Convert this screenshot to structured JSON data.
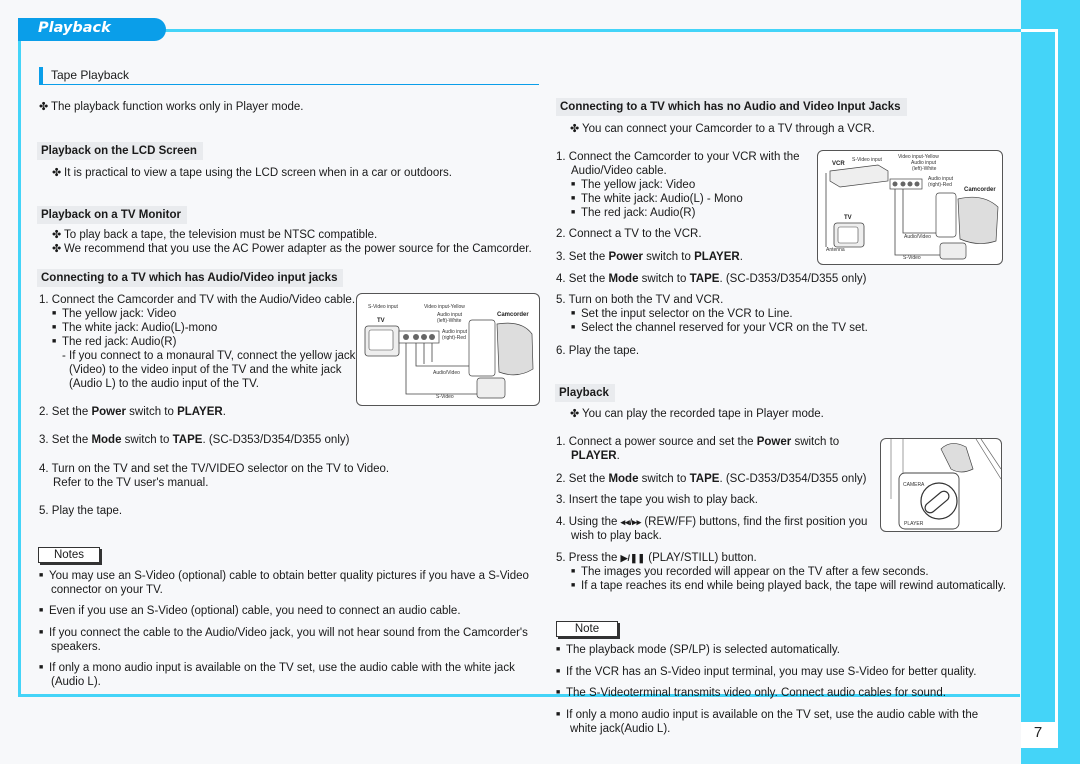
{
  "header": {
    "title": "Playback"
  },
  "section": {
    "title": "Tape Playback"
  },
  "page_number": "7",
  "intro": "The playback function works only in Player mode.",
  "lcd": {
    "heading": "Playback on the LCD Screen",
    "text": "It is practical to view a tape using the LCD screen when in a car or outdoors."
  },
  "tv_monitor": {
    "heading": "Playback on a TV Monitor",
    "items": [
      "To play back a tape, the television must be NTSC compatible.",
      "We recommend that you use the AC Power adapter as the power source for the Camcorder."
    ]
  },
  "av_jacks": {
    "heading": "Connecting to a TV which has Audio/Video input jacks",
    "step1": "1. Connect the Camcorder and TV with the Audio/Video cable.",
    "bullets": [
      "The yellow jack: Video",
      "The white jack: Audio(L)-mono",
      "The red jack: Audio(R)"
    ],
    "dash": [
      "- If you connect to a monaural TV, connect the yellow jack",
      "(Video) to the video input of the TV and the white jack",
      "(Audio L) to the audio input of the TV."
    ],
    "step2": {
      "pre": "2. Set the ",
      "b1": "Power",
      "mid": " switch to ",
      "b2": "PLAYER",
      "post": "."
    },
    "step3": {
      "pre": "3. Set the ",
      "b1": "Mode",
      "mid": " switch to ",
      "b2": "TAPE",
      "post": ". (SC-D353/D354/D355 only)"
    },
    "step4": [
      "4. Turn on the TV and set the TV/VIDEO selector on the TV to Video.",
      "Refer to the TV user's manual."
    ],
    "step5": "5. Play the tape.",
    "diagram": {
      "labels": {
        "svideo_input": "S-Video input",
        "video_input": "Video input-Yellow",
        "audio_left": "Audio input",
        "audio_left2": "(left)-White",
        "audio_right": "Audio input",
        "audio_right2": "(right)-Red",
        "tv": "TV",
        "camcorder": "Camcorder",
        "audio_video": "Audio/Video",
        "svideo": "S-Video"
      }
    }
  },
  "notes": {
    "label": "Notes",
    "items": [
      [
        "You may use an S-Video (optional) cable to obtain better quality pictures if you have a S-Video",
        "connector on your TV."
      ],
      [
        "Even if you use an S-Video (optional) cable, you need to connect an audio cable."
      ],
      [
        "If you connect the cable to the Audio/Video jack, you will not hear sound from the Camcorder's",
        "speakers."
      ],
      [
        "If only a mono audio input is available on the TV set, use the audio cable with the white jack",
        "(Audio L)."
      ]
    ]
  },
  "no_av": {
    "heading": "Connecting to a TV which has no Audio and Video Input Jacks",
    "intro": "You can connect your Camcorder to a TV through a VCR.",
    "step1": [
      "1. Connect the Camcorder to your VCR with the",
      "Audio/Video cable."
    ],
    "bullets": [
      "The yellow jack: Video",
      "The white jack: Audio(L) - Mono",
      "The red jack: Audio(R)"
    ],
    "step2": "2. Connect a TV to the VCR.",
    "step3": {
      "pre": "3. Set the ",
      "b1": "Power",
      "mid": " switch to ",
      "b2": "PLAYER",
      "post": "."
    },
    "step4": {
      "pre": "4. Set the ",
      "b1": "Mode",
      "mid": " switch to ",
      "b2": "TAPE",
      "post": ". (SC-D353/D354/D355 only)"
    },
    "step5": "5. Turn on both the TV and VCR.",
    "step5_bullets": [
      "Set the input selector on the VCR to Line.",
      "Select the channel reserved for your VCR on the TV set."
    ],
    "step6": "6. Play the tape.",
    "diagram": {
      "labels": {
        "vcr": "VCR",
        "svideo_input": "S-Video input",
        "video_input": "Video input-Yellow",
        "audio_left": "Audio input",
        "audio_left2": "(left)-White",
        "audio_right": "Audio input",
        "audio_right2": "(right)-Red",
        "tv": "TV",
        "antenna": "Antenna",
        "camcorder": "Camcorder",
        "audio_video": "Audio/Video",
        "svideo": "S-Video"
      }
    }
  },
  "playback": {
    "heading": "Playback",
    "intro": "You can play the recorded tape in Player mode.",
    "step1": {
      "pre": "1. Connect a power source and set the ",
      "b1": "Power",
      "mid": " switch to",
      "b2": "PLAYER",
      "post": "."
    },
    "step2": {
      "pre": "2. Set the ",
      "b1": "Mode",
      "mid": " switch to ",
      "b2": "TAPE",
      "post": ". (SC-D353/D354/D355 only)"
    },
    "step3": "3. Insert the tape you wish to play back.",
    "step4": {
      "pre": "4. Using the ",
      "icon": "◂◂/▸▸",
      "post": " (REW/FF) buttons, find the first position you",
      "line2": "wish to play back."
    },
    "step5": {
      "pre": "5. Press the ",
      "icon": "▶/❚❚",
      "post": " (PLAY/STILL) button."
    },
    "step5_bullets": [
      "The images you recorded will appear on the TV after a few seconds.",
      "If a tape reaches its end while being played back, the tape will rewind automatically."
    ],
    "diagram": {
      "camera": "CAMERA",
      "player": "PLAYER"
    }
  },
  "note": {
    "label": "Note",
    "items": [
      [
        "The playback mode (SP/LP) is selected automatically."
      ],
      [
        "If the VCR has an S-Video input terminal, you may use S-Video for better quality."
      ],
      [
        "The S-Videoterminal transmits video only. Connect audio cables for sound."
      ],
      [
        "If only a mono audio input is available on the TV set, use the audio cable with the",
        "white jack(Audio L)."
      ]
    ]
  },
  "colors": {
    "accent": "#0a9ee9",
    "band": "#44d4f8",
    "heading_bg": "#e9ebee"
  }
}
